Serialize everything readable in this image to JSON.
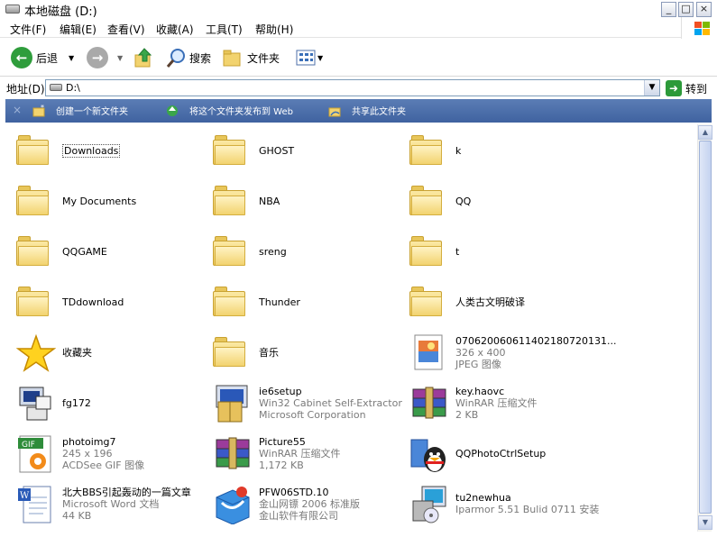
{
  "window": {
    "title": "本地磁盘 (D:)",
    "minimize": "_",
    "maximize": "□",
    "close": "×"
  },
  "menu": [
    "文件(F)",
    "编辑(E)",
    "查看(V)",
    "收藏(A)",
    "工具(T)",
    "帮助(H)"
  ],
  "toolbar": {
    "back": "后退",
    "search": "搜索",
    "folders": "文件夹"
  },
  "address": {
    "label": "地址(D)",
    "value": "D:\\",
    "go": "转到"
  },
  "tasks": [
    "创建一个新文件夹",
    "将这个文件夹发布到 Web",
    "共享此文件夹"
  ],
  "items": [
    {
      "name": "Downloads",
      "type": "folder"
    },
    {
      "name": "GHOST",
      "type": "folder"
    },
    {
      "name": "k",
      "type": "folder"
    },
    {
      "name": "My Documents",
      "type": "folder"
    },
    {
      "name": "NBA",
      "type": "folder"
    },
    {
      "name": "QQ",
      "type": "folder"
    },
    {
      "name": "QQGAME",
      "type": "folder"
    },
    {
      "name": "sreng",
      "type": "folder"
    },
    {
      "name": "t",
      "type": "folder"
    },
    {
      "name": "TDdownload",
      "type": "folder"
    },
    {
      "name": "Thunder",
      "type": "folder"
    },
    {
      "name": "人类古文明破译",
      "type": "folder"
    },
    {
      "name": "收藏夹",
      "type": "favorites"
    },
    {
      "name": "音乐",
      "type": "folder"
    },
    {
      "name": "07062006061140218072013​1...",
      "sub": [
        "326 x 400",
        "JPEG 图像"
      ],
      "type": "jpeg"
    },
    {
      "name": "fg172",
      "type": "exe"
    },
    {
      "name": "ie6setup",
      "sub": [
        "Win32 Cabinet Self-Extractor",
        "Microsoft Corporation"
      ],
      "type": "setup"
    },
    {
      "name": "key.haovc",
      "sub": [
        "WinRAR 压缩文件",
        "2 KB"
      ],
      "type": "rar"
    },
    {
      "name": "photoimg7",
      "sub": [
        "245 x 196",
        "ACDSee GIF 图像"
      ],
      "type": "gif"
    },
    {
      "name": "Picture55",
      "sub": [
        "WinRAR 压缩文件",
        "1,172 KB"
      ],
      "type": "rar"
    },
    {
      "name": "QQPhotoCtrlSetup",
      "type": "qq"
    },
    {
      "name": "北大BBS引起轰动的一篇文章",
      "sub": [
        "Microsoft Word 文档",
        "44 KB"
      ],
      "type": "word"
    },
    {
      "name": "PFW06STD.10",
      "sub": [
        "金山网镖 2006 标准版",
        "金山软件有限公司"
      ],
      "type": "pfw"
    },
    {
      "name": "tu2newhua",
      "sub": [
        "Iparmor 5.51 Bulid 0711 安装"
      ],
      "type": "install"
    }
  ],
  "colors": {
    "taskbar": "#4a6cab",
    "folder": "#f2d36f",
    "go": "#2c9a3a"
  }
}
